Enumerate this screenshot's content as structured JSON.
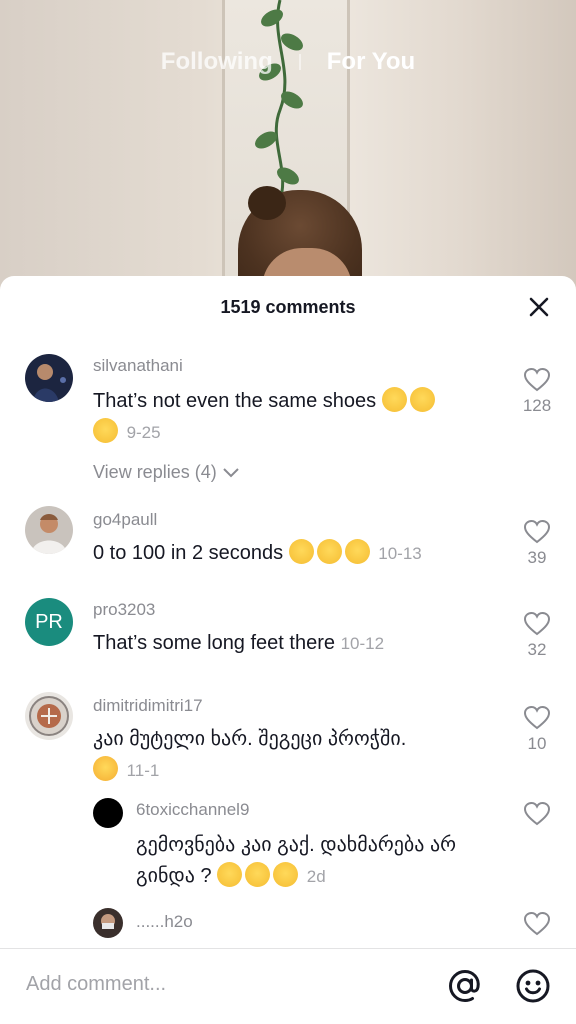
{
  "top_nav": {
    "following_label": "Following",
    "for_you_label": "For You"
  },
  "sheet": {
    "title": "1519 comments"
  },
  "comments": [
    {
      "username": "silvanathani",
      "text_line1": "That’s not even the same shoes",
      "timestamp": "9-25",
      "likes": "128",
      "view_replies_label": "View replies (4)"
    },
    {
      "username": "go4paull",
      "text": "0 to 100 in 2 seconds",
      "timestamp": "10-13",
      "likes": "39"
    },
    {
      "username": "pro3203",
      "avatar_initials": "PR",
      "avatar_color": "#1a8c7e",
      "text": "That’s some long feet there",
      "timestamp": "10-12",
      "likes": "32"
    },
    {
      "username": "dimitridimitri17",
      "text": "კაი მუტელი ხარ. შეგეცი პროჭში.",
      "timestamp": "11-1",
      "likes": "10"
    }
  ],
  "replies": [
    {
      "username": "6toxicchannel9",
      "text": "გემოვნება კაი გაქ. დახმარება არ გინდა ?",
      "timestamp": "2d"
    },
    {
      "username": "......h2o"
    }
  ],
  "bottom_bar": {
    "placeholder": "Add comment..."
  },
  "colors": {
    "accent_text": "#161823",
    "muted_text": "#8a8b91"
  },
  "icons": [
    "close-icon",
    "heart-outline-icon",
    "chevron-down-icon",
    "at-sign-icon",
    "smiley-icon"
  ]
}
